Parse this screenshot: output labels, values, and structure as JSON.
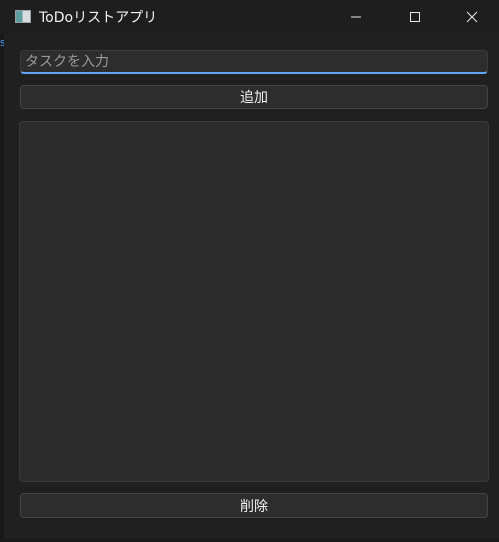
{
  "window": {
    "title": "ToDoリストアプリ"
  },
  "icons": {
    "app": "app-window-icon",
    "minimize": "minimize-icon",
    "maximize": "maximize-icon",
    "close": "close-icon"
  },
  "form": {
    "task_input_value": "",
    "task_input_placeholder": "タスクを入力",
    "add_label": "追加",
    "delete_label": "削除"
  },
  "task_list": {
    "items": []
  },
  "colors": {
    "background": "#202020",
    "surface": "#2d2d2d",
    "accent": "#60a5fa",
    "text": "#f0f0f0"
  }
}
